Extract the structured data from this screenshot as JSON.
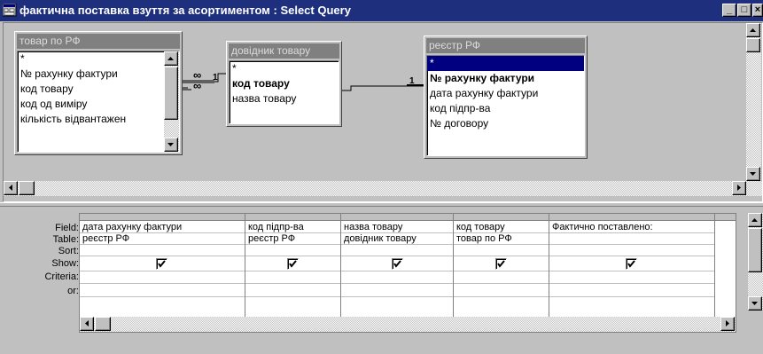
{
  "window": {
    "title": "фактична поставка взуття за асортиментом : Select Query",
    "minimize": "_",
    "restore": "□",
    "close": "×"
  },
  "tables": [
    {
      "title": "товар по РФ",
      "fields": [
        "*",
        "№ рахунку фактури",
        "код товару",
        "код од виміру",
        "кількість відвантажен"
      ]
    },
    {
      "title": "довідник товару",
      "fields": [
        "*",
        "код товару",
        "назва товару"
      ]
    },
    {
      "title": "реєстр РФ",
      "fields": [
        "*",
        "№ рахунку фактури",
        "дата  рахунку фактури",
        "код підпр-ва",
        "№ договору"
      ]
    }
  ],
  "relations": [
    {
      "many": "∞",
      "one": "1"
    },
    {
      "many": "∞",
      "one": "1"
    }
  ],
  "grid": {
    "row_labels": [
      "Field:",
      "Table:",
      "Sort:",
      "Show:",
      "Criteria:",
      "or:"
    ],
    "columns": [
      {
        "field": "дата  рахунку фактури",
        "table": "реєстр РФ",
        "show": true
      },
      {
        "field": "код підпр-ва",
        "table": "реєстр РФ",
        "show": true
      },
      {
        "field": "назва товару",
        "table": "довідник товару",
        "show": true
      },
      {
        "field": "код товару",
        "table": "товар по РФ",
        "show": true
      },
      {
        "field": "Фактично поставлено:",
        "table": "",
        "show": true
      }
    ]
  }
}
